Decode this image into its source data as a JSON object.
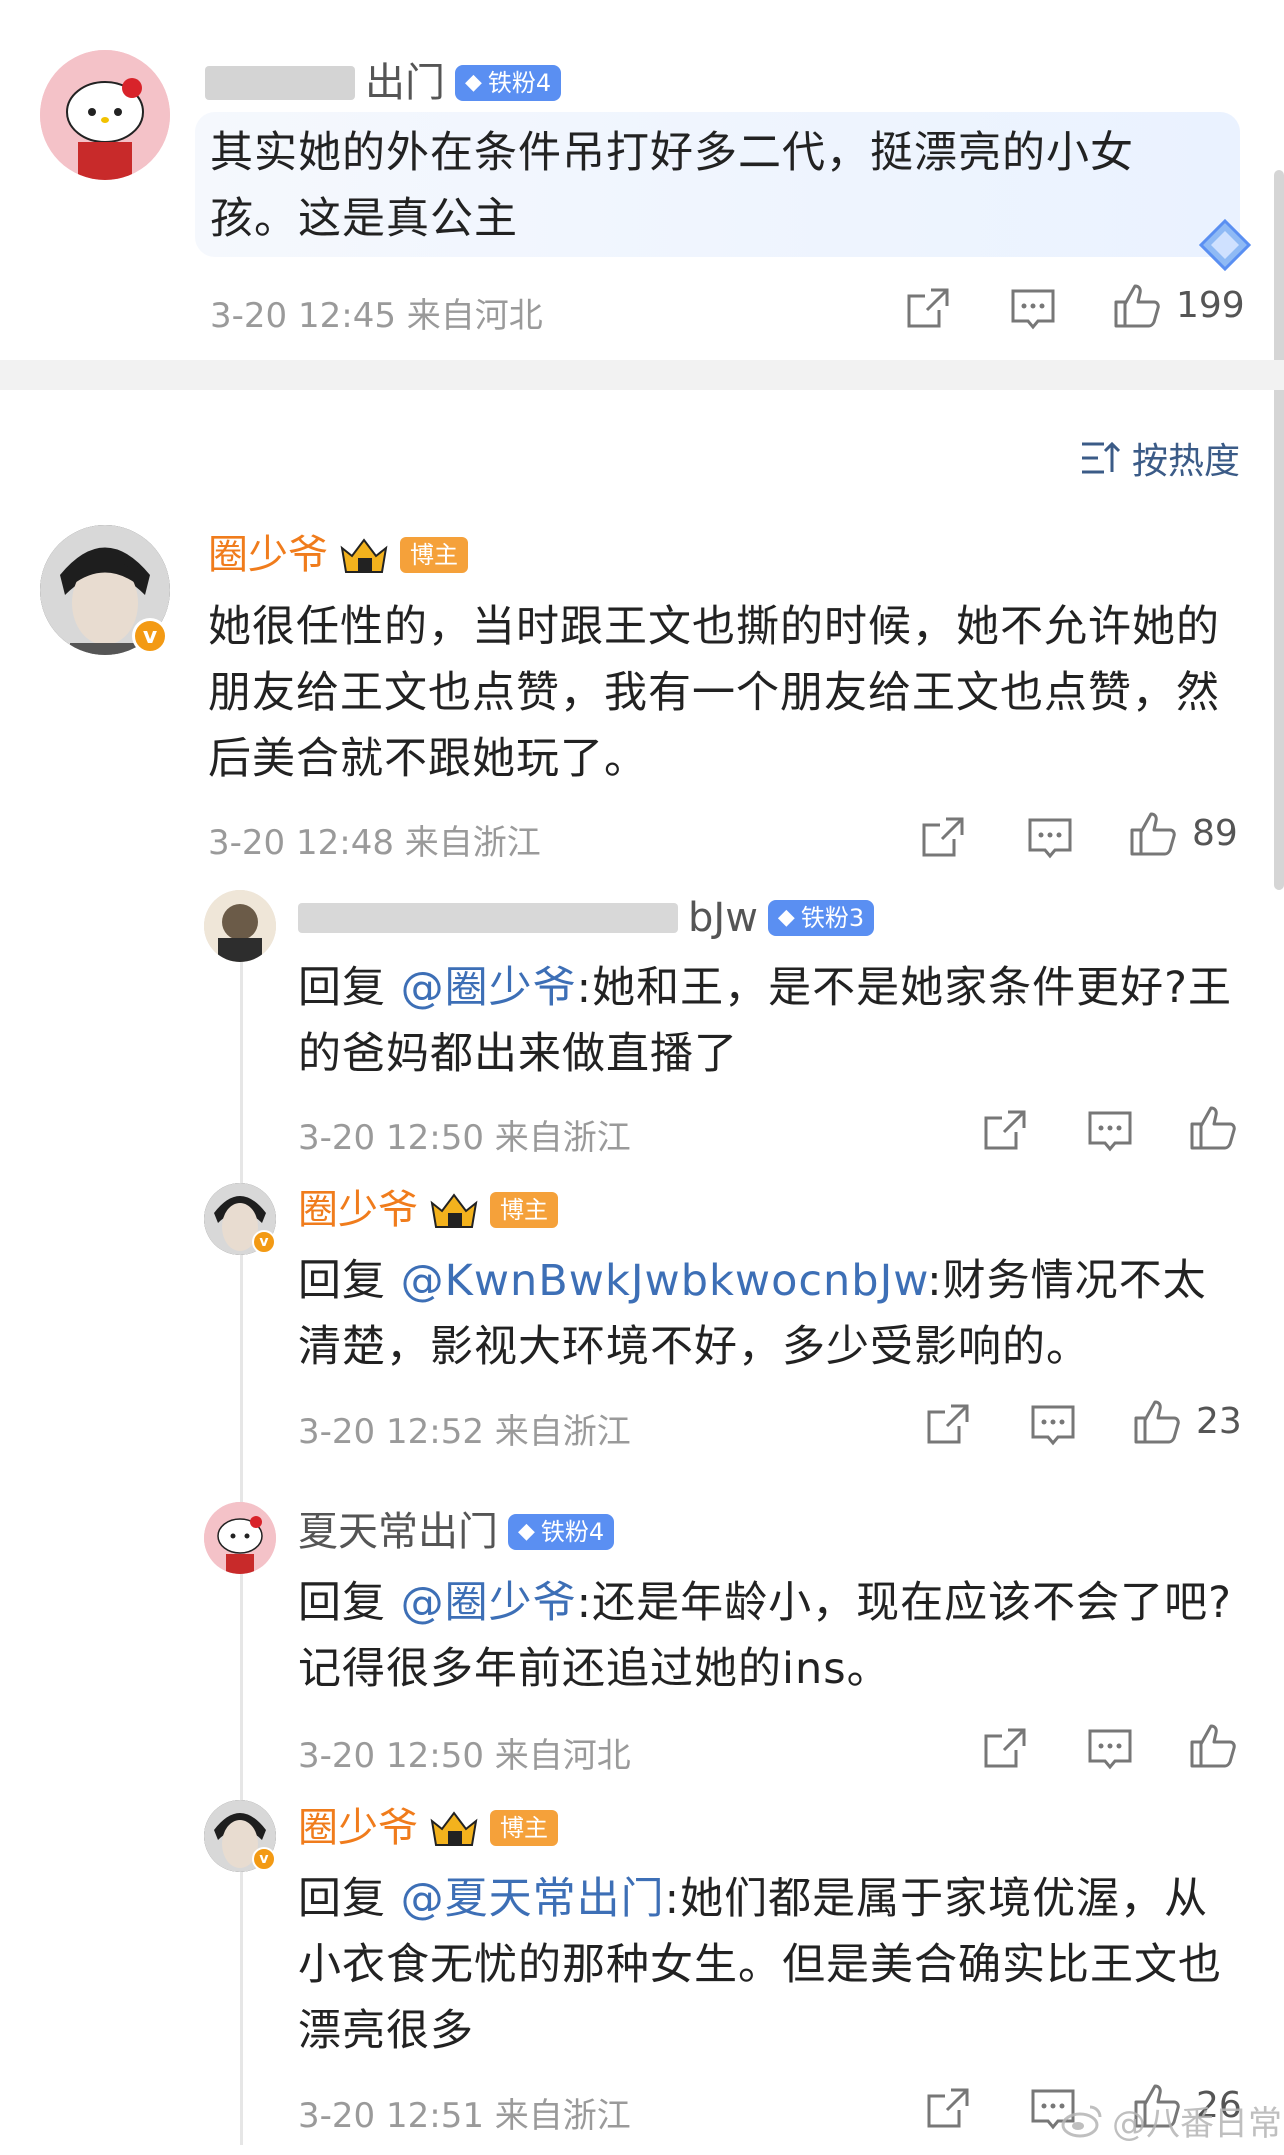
{
  "top_comment": {
    "username": "出门",
    "fan_badge": "铁粉4",
    "text": "其实她的外在条件吊打好多二代，挺漂亮的小女孩。这是真公主",
    "meta": "3-20 12:45  来自河北",
    "likes": "199"
  },
  "sort": {
    "label": "按热度"
  },
  "main_comment": {
    "username": "圈少爷",
    "blogger_badge": "博主",
    "text": "她很任性的，当时跟王文也撕的时候，她不允许她的朋友给王文也点赞，我有一个朋友给王文也点赞，然后美合就不跟她玩了。",
    "meta": "3-20 12:48  来自浙江",
    "likes": "89"
  },
  "replies": [
    {
      "username": "bJw",
      "fan_badge": "铁粉3",
      "reply_prefix": "回复 ",
      "mention": "@圈少爷",
      "text": ":她和王，是不是她家条件更好?王的爸妈都出来做直播了",
      "meta": "3-20 12:50  来自浙江",
      "likes": ""
    },
    {
      "username": "圈少爷",
      "blogger_badge": "博主",
      "reply_prefix": "回复 ",
      "mention": "@KwnBwkJwbkwocnbJw",
      "text": ":财务情况不太清楚，影视大环境不好，多少受影响的。",
      "meta": "3-20 12:52  来自浙江",
      "likes": "23"
    },
    {
      "username": "夏天常出门",
      "fan_badge": "铁粉4",
      "reply_prefix": "回复 ",
      "mention": "@圈少爷",
      "text": ":还是年龄小，现在应该不会了吧? 记得很多年前还追过她的ins。",
      "meta": "3-20 12:50  来自河北",
      "likes": ""
    },
    {
      "username": "圈少爷",
      "blogger_badge": "博主",
      "reply_prefix": "回复 ",
      "mention": "@夏天常出门",
      "text": ":她们都是属于家境优渥，从小衣食无忧的那种女生。但是美合确实比王文也漂亮很多",
      "meta": "3-20 12:51  来自浙江",
      "likes": "26"
    }
  ],
  "watermark": "@八番日常",
  "colors": {
    "blogger_name": "#f07c1c",
    "mention": "#3d6fb6",
    "fan_badge": "#5a8ff2",
    "blogger_badge": "#f5a13a"
  }
}
